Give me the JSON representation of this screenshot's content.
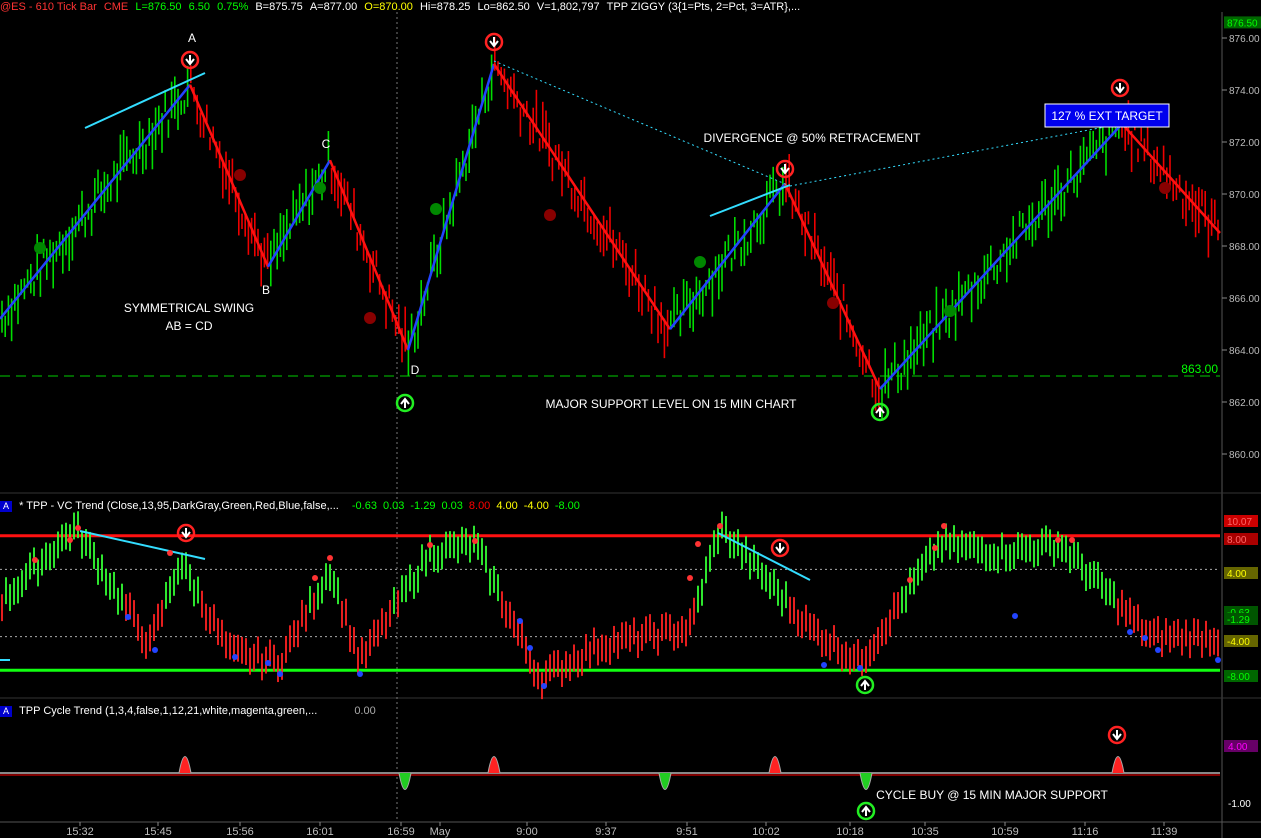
{
  "header": {
    "symbol": "@ES - 610 Tick Bar",
    "exchange": "CME",
    "last": "L=876.50",
    "change": "6.50",
    "pct": "0.75%",
    "bid": "B=875.75",
    "ask": "A=877.00",
    "open": "O=870.00",
    "high": "Hi=878.25",
    "low": "Lo=862.50",
    "volume": "V=1,802,797",
    "study": "TPP ZIGGY (3{1=Pts, 2=Pct, 3=ATR},..."
  },
  "indicator1": {
    "icon": "A",
    "title": "* TPP - VC  Trend (Close,13,95,DarkGray,Green,Red,Blue,false,...",
    "values": [
      {
        "text": "-0.63",
        "color": "#00ff00"
      },
      {
        "text": "0.03",
        "color": "#00ff00"
      },
      {
        "text": "-1.29",
        "color": "#00ff00"
      },
      {
        "text": "0.03",
        "color": "#00ff00"
      },
      {
        "text": "8.00",
        "color": "#ff0000"
      },
      {
        "text": "4.00",
        "color": "#ffff00"
      },
      {
        "text": "-4.00",
        "color": "#ffff00"
      },
      {
        "text": "-8.00",
        "color": "#00ff00"
      }
    ]
  },
  "indicator2": {
    "icon": "A",
    "title": "TPP Cycle Trend (1,3,4,false,1,12,21,white,magenta,green,...",
    "value": "0.00"
  },
  "annotations": {
    "A": "A",
    "B": "B",
    "C": "C",
    "D": "D",
    "swing1": "SYMMETRICAL SWING",
    "swing2": "AB = CD",
    "divergence": "DIVERGENCE @ 50% RETRACEMENT",
    "target": "127 % EXT TARGET",
    "support": "MAJOR SUPPORT LEVEL ON 15 MIN CHART",
    "support_value": "863.00",
    "cycle_buy": "CYCLE BUY @ 15 MIN MAJOR SUPPORT"
  },
  "axis": {
    "price_ticks": [
      "876.00",
      "874.00",
      "872.00",
      "870.00",
      "868.00",
      "866.00",
      "864.00",
      "862.00",
      "860.00"
    ],
    "last_price_tag": "876.50",
    "ind1_tags": [
      {
        "text": "10.07",
        "color": "#cc0000",
        "fg": "#ff6666"
      },
      {
        "text": "8.00",
        "color": "#aa0000",
        "fg": "#ff6666"
      },
      {
        "text": "4.00",
        "color": "#666600",
        "fg": "#ffff00"
      },
      {
        "text": "-0.63",
        "color": "#005500",
        "fg": "#00ff00"
      },
      {
        "text": "-1.29",
        "color": "#005500",
        "fg": "#00ff00"
      },
      {
        "text": "-4.00",
        "color": "#666600",
        "fg": "#ffff00"
      },
      {
        "text": "-8.00",
        "color": "#006600",
        "fg": "#00ff00"
      }
    ],
    "ind2_tags": [
      {
        "text": "4.00",
        "color": "#660066",
        "fg": "#ff00ff"
      },
      {
        "text": "-1.00",
        "color": "#000000",
        "fg": "#ffffff"
      }
    ],
    "time_labels": [
      "15:32",
      "15:45",
      "15:56",
      "16:01",
      "16:59",
      "May",
      "9:00",
      "9:37",
      "9:51",
      "10:02",
      "10:18",
      "10:35",
      "10:59",
      "11:16",
      "11:39"
    ]
  },
  "chart_data": {
    "type": "bar",
    "title": "@ES - 610 Tick Bar",
    "ylim": [
      859,
      877
    ],
    "support_level": 863.0,
    "zigzag": [
      {
        "time": "15:25",
        "price": 865.2
      },
      {
        "time": "15:50",
        "price": 874.2,
        "label": "A"
      },
      {
        "time": "15:58",
        "price": 867.2,
        "label": "B"
      },
      {
        "time": "16:03",
        "price": 871.3,
        "label": "C"
      },
      {
        "time": "16:59",
        "price": 864.0,
        "label": "D"
      },
      {
        "time": "9:10",
        "price": 875.0
      },
      {
        "time": "9:45",
        "price": 864.8
      },
      {
        "time": "10:02",
        "price": 870.4
      },
      {
        "time": "10:22",
        "price": 862.5
      },
      {
        "time": "11:22",
        "price": 872.7
      },
      {
        "time": "11:48",
        "price": 868.5
      }
    ],
    "ind1_levels": [
      8.0,
      4.0,
      -4.0,
      -8.0
    ],
    "ind2_levels": [
      4.0,
      -1.0
    ]
  }
}
